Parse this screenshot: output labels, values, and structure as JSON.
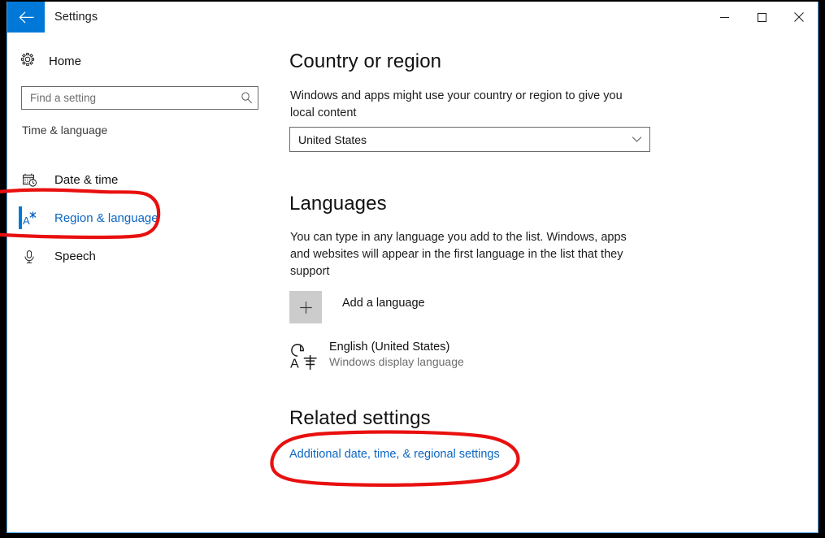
{
  "window": {
    "title": "Settings",
    "back_icon": "back-arrow-icon",
    "controls": {
      "minimize": "minimize-icon",
      "maximize": "maximize-icon",
      "close": "close-icon"
    },
    "accent_color": "#0078d7",
    "border_color": "#4ba3e3"
  },
  "sidebar": {
    "home": {
      "label": "Home",
      "icon": "gear-icon"
    },
    "search": {
      "placeholder": "Find a setting",
      "value": "",
      "icon": "search-icon"
    },
    "category": "Time & language",
    "items": [
      {
        "label": "Date & time",
        "icon": "calendar-clock-icon",
        "selected": false
      },
      {
        "label": "Region & language",
        "icon": "language-a-icon",
        "selected": true
      },
      {
        "label": "Speech",
        "icon": "microphone-icon",
        "selected": false
      }
    ]
  },
  "main": {
    "country": {
      "heading": "Country or region",
      "description": "Windows and apps might use your country or region to give you local content",
      "dropdown_value": "United States",
      "dropdown_icon": "chevron-down-icon"
    },
    "languages": {
      "heading": "Languages",
      "description": "You can type in any language you add to the list. Windows, apps and websites will appear in the first language in the list that they support",
      "add_label": "Add a language",
      "add_icon": "plus-icon",
      "installed": [
        {
          "name": "English (United States)",
          "sub": "Windows display language",
          "icon": "translate-language-icon"
        }
      ]
    },
    "related": {
      "heading": "Related settings",
      "link": "Additional date, time, & regional settings"
    }
  },
  "annotations": {
    "color": "#e8100f",
    "shapes": [
      {
        "name": "sidebar-region-language-circle",
        "target": "Region & language"
      },
      {
        "name": "related-settings-link-circle",
        "target": "Additional date, time, & regional settings"
      }
    ]
  }
}
